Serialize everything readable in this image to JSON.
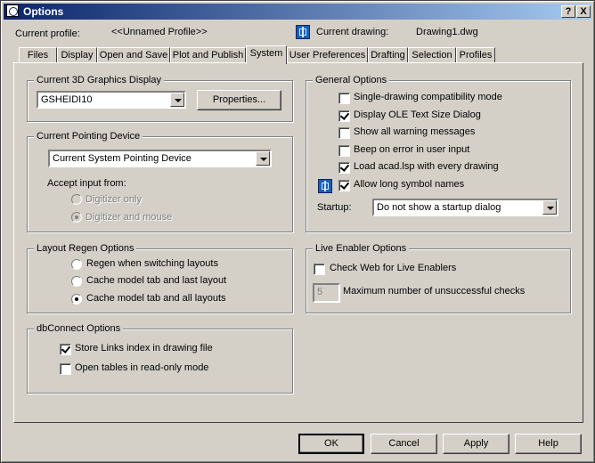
{
  "window": {
    "title": "Options",
    "help_button": "?",
    "close_button": "X"
  },
  "header": {
    "profile_label": "Current profile:",
    "profile_value": "<<Unnamed Profile>>",
    "drawing_label": "Current drawing:",
    "drawing_value": "Drawing1.dwg"
  },
  "tabs": [
    "Files",
    "Display",
    "Open and Save",
    "Plot and Publish",
    "System",
    "User Preferences",
    "Drafting",
    "Selection",
    "Profiles"
  ],
  "active_tab": "System",
  "graphics": {
    "title": "Current 3D Graphics Display",
    "selected": "GSHEIDI10",
    "properties_label": "Properties..."
  },
  "pointing": {
    "title": "Current Pointing Device",
    "selected": "Current System Pointing Device",
    "accept_label": "Accept input from:",
    "options": [
      {
        "label": "Digitizer only",
        "checked": false,
        "enabled": false
      },
      {
        "label": "Digitizer and mouse",
        "checked": true,
        "enabled": false
      }
    ]
  },
  "layout_regen": {
    "title": "Layout Regen Options",
    "options": [
      {
        "label": "Regen when switching layouts",
        "checked": false
      },
      {
        "label": "Cache model tab and last layout",
        "checked": false
      },
      {
        "label": "Cache model tab and all layouts",
        "checked": true
      }
    ]
  },
  "dbconnect": {
    "title": "dbConnect Options",
    "options": [
      {
        "label": "Store Links index in drawing file",
        "checked": true
      },
      {
        "label": "Open tables in read-only mode",
        "checked": false
      }
    ]
  },
  "general": {
    "title": "General Options",
    "options": [
      {
        "label": "Single-drawing compatibility mode",
        "checked": false
      },
      {
        "label": "Display OLE Text Size Dialog",
        "checked": true
      },
      {
        "label": "Show all warning messages",
        "checked": false
      },
      {
        "label": "Beep on error in user input",
        "checked": false
      },
      {
        "label": "Load acad.lsp with every drawing",
        "checked": true
      },
      {
        "label": "Allow long symbol names",
        "checked": true
      }
    ],
    "startup_label": "Startup:",
    "startup_value": "Do not show a startup dialog"
  },
  "live_enabler": {
    "title": "Live Enabler Options",
    "check_web_label": "Check Web for Live Enablers",
    "check_web_checked": false,
    "max_checks_value": "5",
    "max_checks_label": "Maximum number of unsuccessful checks"
  },
  "footer": {
    "ok": "OK",
    "cancel": "Cancel",
    "apply": "Apply",
    "help": "Help"
  },
  "icons": {
    "app": "options-window-icon",
    "drawing": "drawing-settings-icon",
    "symbol": "drawing-settings-icon"
  }
}
